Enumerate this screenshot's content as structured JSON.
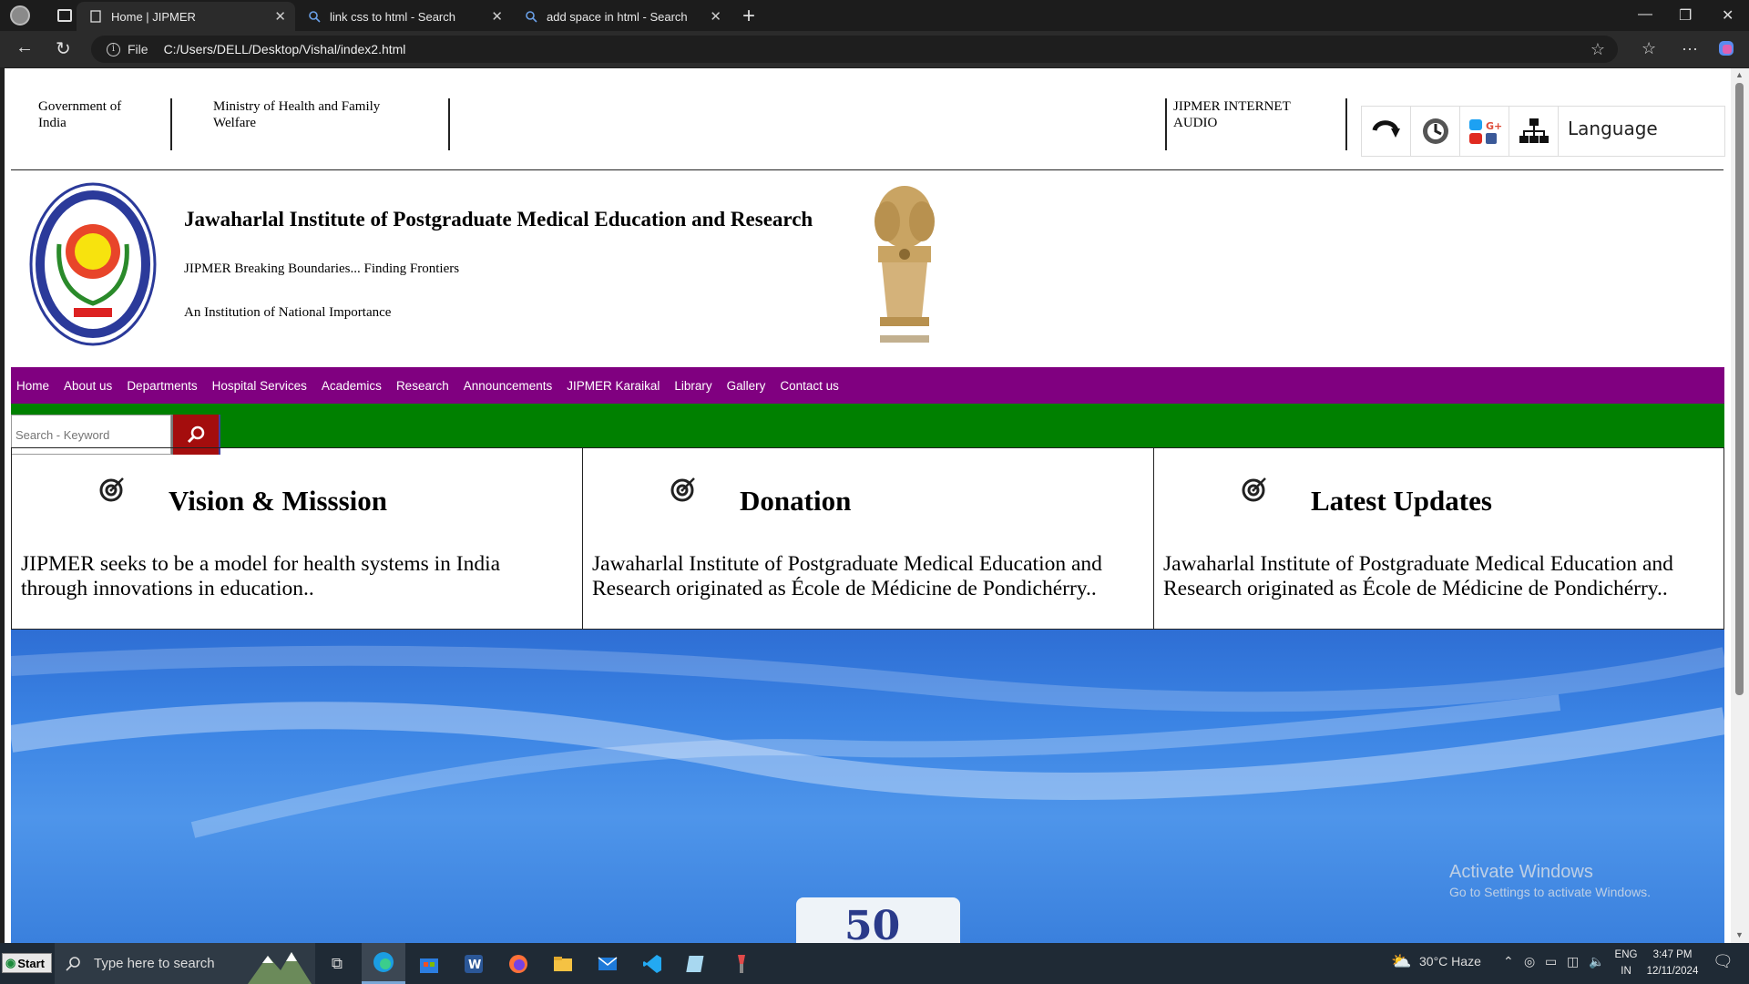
{
  "browser": {
    "tabs": [
      {
        "title": "Home | JIPMER"
      },
      {
        "title": "link css to html - Search"
      },
      {
        "title": "add space in html - Search"
      }
    ],
    "address": {
      "scheme_label": "File",
      "url": "C:/Users/DELL/Desktop/Vishal/index2.html"
    }
  },
  "top_strip": {
    "gov": "Government of India",
    "ministry": "Ministry of Health and Family Welfare",
    "audio": "JIPMER INTERNET AUDIO",
    "language": "Language"
  },
  "header": {
    "title": "Jawaharlal Institute of Postgraduate Medical Education and Research",
    "tagline": "JIPMER Breaking Boundaries... Finding Frontiers",
    "subtitle": "An Institution of National Importance"
  },
  "menu": {
    "items": [
      "Home",
      "About us",
      "Departments",
      "Hospital Services",
      "Academics",
      "Research",
      "Announcements",
      "JIPMER Karaikal",
      "Library",
      "Gallery",
      "Contact us"
    ]
  },
  "search": {
    "placeholder": "Search - Keyword"
  },
  "cards": [
    {
      "title": "Vision & Misssion",
      "text": "JIPMER seeks to be a model for health systems in India through innovations in education.."
    },
    {
      "title": "Donation",
      "text": "Jawaharlal Institute of Postgraduate Medical Education and Research originated as École de Médicine de Pondichérry.."
    },
    {
      "title": "Latest Updates",
      "text": "Jawaharlal Institute of Postgraduate Medical Education and Research originated as École de Médicine de Pondichérry.."
    }
  ],
  "watermark": {
    "line1": "Activate Windows",
    "line2": "Go to Settings to activate Windows."
  },
  "taskbar": {
    "start": "Start",
    "search_placeholder": "Type here to search",
    "weather": "30°C  Haze",
    "lang1": "ENG",
    "lang2": "IN",
    "time": "3:47 PM",
    "date": "12/11/2024"
  },
  "colors": {
    "menu_bg": "#800080",
    "search_bar_bg": "#008000",
    "search_btn": "#a40d0d"
  }
}
